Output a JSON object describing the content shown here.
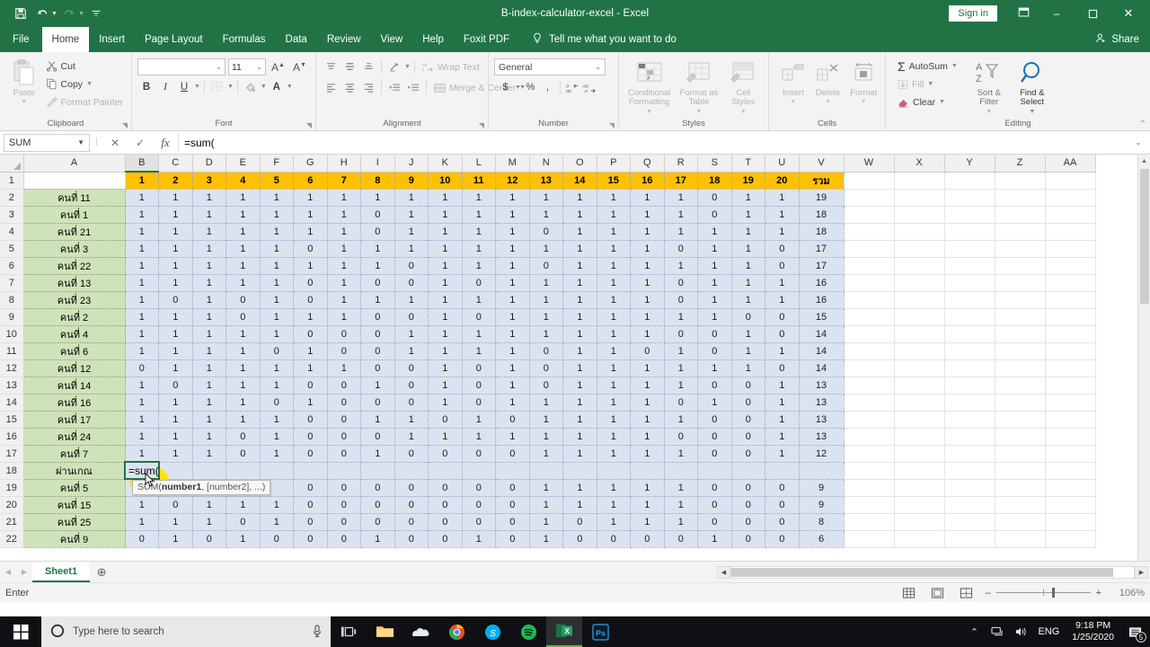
{
  "window": {
    "title": "B-index-calculator-excel  -  Excel",
    "signin_label": "Sign in",
    "quick_access": [
      "save-icon",
      "undo-icon",
      "redo-icon",
      "customize-qat-icon"
    ],
    "buttons": {
      "ribbon_display": "ribbon-display-options-icon",
      "minimize": "–",
      "restore": "❐",
      "close": "✕"
    }
  },
  "ribbon_tabs": [
    {
      "label": "File",
      "active": false
    },
    {
      "label": "Home",
      "active": true
    },
    {
      "label": "Insert",
      "active": false
    },
    {
      "label": "Page Layout",
      "active": false
    },
    {
      "label": "Formulas",
      "active": false
    },
    {
      "label": "Data",
      "active": false
    },
    {
      "label": "Review",
      "active": false
    },
    {
      "label": "View",
      "active": false
    },
    {
      "label": "Help",
      "active": false
    },
    {
      "label": "Foxit PDF",
      "active": false
    }
  ],
  "tell_me": "Tell me what you want to do",
  "share_label": "Share",
  "ribbon": {
    "clipboard": {
      "label": "Clipboard",
      "paste": "Paste",
      "cut": "Cut",
      "copy": "Copy",
      "format_painter": "Format Painter"
    },
    "font": {
      "label": "Font",
      "font_name": "",
      "font_size": "11",
      "grow_font": "A",
      "shrink_font": "A",
      "bold": "B",
      "italic": "I",
      "underline": "U",
      "borders": "borders-icon",
      "fill_color": "fill-color-icon",
      "font_color": "A"
    },
    "alignment": {
      "label": "Alignment",
      "wrap_text": "Wrap Text",
      "merge_center": "Merge & Center"
    },
    "number": {
      "label": "Number",
      "format": "General",
      "currency": "$",
      "percent": "%",
      "comma": ",",
      "increase_decimal": ".00",
      "decrease_decimal": ".00"
    },
    "styles": {
      "label": "Styles",
      "conditional_formatting": "Conditional Formatting",
      "format_as_table": "Format as Table",
      "cell_styles": "Cell Styles"
    },
    "cells": {
      "label": "Cells",
      "insert": "Insert",
      "delete": "Delete",
      "format": "Format"
    },
    "editing": {
      "label": "Editing",
      "autosum": "AutoSum",
      "fill": "Fill",
      "clear": "Clear",
      "sort_filter": "Sort & Filter",
      "find_select": "Find & Select"
    }
  },
  "formula_bar": {
    "name_box": "SUM",
    "cancel": "✕",
    "enter": "✓",
    "insert_function": "fx",
    "value": "=sum("
  },
  "grid": {
    "columns": [
      "A",
      "B",
      "C",
      "D",
      "E",
      "F",
      "G",
      "H",
      "I",
      "J",
      "K",
      "L",
      "M",
      "N",
      "O",
      "P",
      "Q",
      "R",
      "S",
      "T",
      "U",
      "V",
      "W",
      "X",
      "Y",
      "Z",
      "AA"
    ],
    "selected_column": "B",
    "rows": [
      {
        "n": 1,
        "name": "",
        "values": [
          "1",
          "2",
          "3",
          "4",
          "5",
          "6",
          "7",
          "8",
          "9",
          "10",
          "11",
          "12",
          "13",
          "14",
          "15",
          "16",
          "17",
          "18",
          "19",
          "20"
        ],
        "total": "รวม",
        "style": "header"
      },
      {
        "n": 2,
        "name": "คนที่ 11",
        "values": [
          "1",
          "1",
          "1",
          "1",
          "1",
          "1",
          "1",
          "1",
          "1",
          "1",
          "1",
          "1",
          "1",
          "1",
          "1",
          "1",
          "1",
          "0",
          "1",
          "1"
        ],
        "total": "19"
      },
      {
        "n": 3,
        "name": "คนที่ 1",
        "values": [
          "1",
          "1",
          "1",
          "1",
          "1",
          "1",
          "1",
          "0",
          "1",
          "1",
          "1",
          "1",
          "1",
          "1",
          "1",
          "1",
          "1",
          "0",
          "1",
          "1"
        ],
        "total": "18"
      },
      {
        "n": 4,
        "name": "คนที่ 21",
        "values": [
          "1",
          "1",
          "1",
          "1",
          "1",
          "1",
          "1",
          "0",
          "1",
          "1",
          "1",
          "1",
          "0",
          "1",
          "1",
          "1",
          "1",
          "1",
          "1",
          "1"
        ],
        "total": "18"
      },
      {
        "n": 5,
        "name": "คนที่ 3",
        "values": [
          "1",
          "1",
          "1",
          "1",
          "1",
          "0",
          "1",
          "1",
          "1",
          "1",
          "1",
          "1",
          "1",
          "1",
          "1",
          "1",
          "0",
          "1",
          "1",
          "0"
        ],
        "total": "17"
      },
      {
        "n": 6,
        "name": "คนที่ 22",
        "values": [
          "1",
          "1",
          "1",
          "1",
          "1",
          "1",
          "1",
          "1",
          "0",
          "1",
          "1",
          "1",
          "0",
          "1",
          "1",
          "1",
          "1",
          "1",
          "1",
          "0"
        ],
        "total": "17"
      },
      {
        "n": 7,
        "name": "คนที่ 13",
        "values": [
          "1",
          "1",
          "1",
          "1",
          "1",
          "0",
          "1",
          "0",
          "0",
          "1",
          "0",
          "1",
          "1",
          "1",
          "1",
          "1",
          "0",
          "1",
          "1",
          "1"
        ],
        "total": "16"
      },
      {
        "n": 8,
        "name": "คนที่ 23",
        "values": [
          "1",
          "0",
          "1",
          "0",
          "1",
          "0",
          "1",
          "1",
          "1",
          "1",
          "1",
          "1",
          "1",
          "1",
          "1",
          "1",
          "0",
          "1",
          "1",
          "1"
        ],
        "total": "16"
      },
      {
        "n": 9,
        "name": "คนที่ 2",
        "values": [
          "1",
          "1",
          "1",
          "0",
          "1",
          "1",
          "1",
          "0",
          "0",
          "1",
          "0",
          "1",
          "1",
          "1",
          "1",
          "1",
          "1",
          "1",
          "0",
          "0"
        ],
        "total": "15"
      },
      {
        "n": 10,
        "name": "คนที่ 4",
        "values": [
          "1",
          "1",
          "1",
          "1",
          "1",
          "0",
          "0",
          "0",
          "1",
          "1",
          "1",
          "1",
          "1",
          "1",
          "1",
          "1",
          "0",
          "0",
          "1",
          "0"
        ],
        "total": "14"
      },
      {
        "n": 11,
        "name": "คนที่ 6",
        "values": [
          "1",
          "1",
          "1",
          "1",
          "0",
          "1",
          "0",
          "0",
          "1",
          "1",
          "1",
          "1",
          "0",
          "1",
          "1",
          "0",
          "1",
          "0",
          "1",
          "1"
        ],
        "total": "14"
      },
      {
        "n": 12,
        "name": "คนที่ 12",
        "values": [
          "0",
          "1",
          "1",
          "1",
          "1",
          "1",
          "1",
          "0",
          "0",
          "1",
          "0",
          "1",
          "0",
          "1",
          "1",
          "1",
          "1",
          "1",
          "1",
          "0"
        ],
        "total": "14"
      },
      {
        "n": 13,
        "name": "คนที่ 14",
        "values": [
          "1",
          "0",
          "1",
          "1",
          "1",
          "0",
          "0",
          "1",
          "0",
          "1",
          "0",
          "1",
          "0",
          "1",
          "1",
          "1",
          "1",
          "0",
          "0",
          "1"
        ],
        "total": "13"
      },
      {
        "n": 14,
        "name": "คนที่ 16",
        "values": [
          "1",
          "1",
          "1",
          "1",
          "0",
          "1",
          "0",
          "0",
          "0",
          "1",
          "0",
          "1",
          "1",
          "1",
          "1",
          "1",
          "0",
          "1",
          "0",
          "1"
        ],
        "total": "13"
      },
      {
        "n": 15,
        "name": "คนที่ 17",
        "values": [
          "1",
          "1",
          "1",
          "1",
          "1",
          "0",
          "0",
          "1",
          "1",
          "0",
          "1",
          "0",
          "1",
          "1",
          "1",
          "1",
          "1",
          "0",
          "0",
          "1"
        ],
        "total": "13"
      },
      {
        "n": 16,
        "name": "คนที่ 24",
        "values": [
          "1",
          "1",
          "1",
          "0",
          "1",
          "0",
          "0",
          "0",
          "1",
          "1",
          "1",
          "1",
          "1",
          "1",
          "1",
          "1",
          "0",
          "0",
          "0",
          "1"
        ],
        "total": "13"
      },
      {
        "n": 17,
        "name": "คนที่ 7",
        "values": [
          "1",
          "1",
          "1",
          "0",
          "1",
          "0",
          "0",
          "1",
          "0",
          "0",
          "0",
          "0",
          "1",
          "1",
          "1",
          "1",
          "1",
          "0",
          "0",
          "1"
        ],
        "total": "12"
      },
      {
        "n": 18,
        "name": "ผ่านเกณ",
        "values": [
          "=sum(",
          "",
          "",
          "",
          "",
          "",
          "",
          "",
          "",
          "",
          "",
          "",
          "",
          "",
          "",
          "",
          "",
          "",
          "",
          ""
        ],
        "total": "",
        "style": "editing"
      },
      {
        "n": 19,
        "name": "คนที่ 5",
        "values": [
          "",
          "",
          "",
          "",
          "",
          "0",
          "0",
          "0",
          "0",
          "0",
          "0",
          "0",
          "1",
          "1",
          "1",
          "1",
          "1",
          "0",
          "0",
          "0"
        ],
        "total": "9"
      },
      {
        "n": 20,
        "name": "คนที่ 15",
        "values": [
          "1",
          "0",
          "1",
          "1",
          "1",
          "0",
          "0",
          "0",
          "0",
          "0",
          "0",
          "0",
          "1",
          "1",
          "1",
          "1",
          "1",
          "0",
          "0",
          "0"
        ],
        "total": "9"
      },
      {
        "n": 21,
        "name": "คนที่ 25",
        "values": [
          "1",
          "1",
          "1",
          "0",
          "1",
          "0",
          "0",
          "0",
          "0",
          "0",
          "0",
          "0",
          "1",
          "0",
          "1",
          "1",
          "1",
          "0",
          "0",
          "0"
        ],
        "total": "8"
      },
      {
        "n": 22,
        "name": "คนที่ 9",
        "values": [
          "0",
          "1",
          "0",
          "1",
          "0",
          "0",
          "0",
          "1",
          "0",
          "0",
          "1",
          "0",
          "1",
          "0",
          "0",
          "0",
          "0",
          "1",
          "0",
          "0"
        ],
        "total": "6"
      }
    ]
  },
  "editing_cell": {
    "address": "B18",
    "text": "=sum(",
    "tooltip_prefix": "SUM(",
    "tooltip_bold": "number1",
    "tooltip_suffix": ", [number2], ...)"
  },
  "sheet_bar": {
    "tabs": [
      "Sheet1"
    ],
    "active": "Sheet1",
    "add_label": "⊕"
  },
  "status_bar": {
    "mode": "Enter",
    "views": [
      "normal-view-icon",
      "page-layout-view-icon",
      "page-break-preview-icon"
    ],
    "zoom_out": "–",
    "zoom_in": "+",
    "zoom": "106%"
  },
  "taskbar": {
    "start": "windows-logo-icon",
    "search_placeholder": "Type here to search",
    "mic": "microphone-icon",
    "pinned": [
      "task-view-icon",
      "file-explorer-icon",
      "onedrive-icon",
      "chrome-icon",
      "skype-icon",
      "spotify-icon",
      "excel-icon",
      "photoshop-icon"
    ],
    "tray": {
      "overflow": "chevron-up-icon",
      "network": "network-icon",
      "volume": "speaker-icon",
      "language": "ENG",
      "time": "9:18 PM",
      "date": "1/25/2020",
      "action_center": "action-center-icon",
      "notification_count": "5"
    }
  },
  "colors": {
    "excel_green": "#217346",
    "header_orange": "#ffc000",
    "name_green": "#cfe3ba",
    "data_blue": "#dce3f0",
    "cursor_yellow": "#ffe400"
  }
}
